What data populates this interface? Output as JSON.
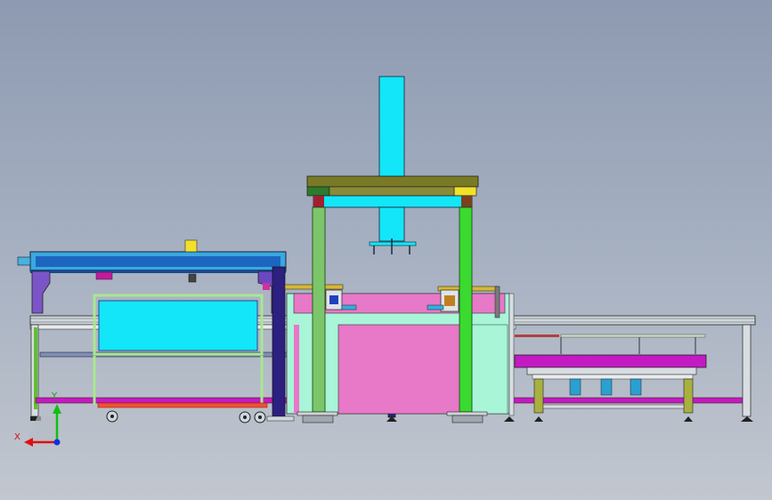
{
  "viewport": {
    "background_top": "#8e9ab1",
    "background_bottom": "#c2c7cf"
  },
  "triad": {
    "x_label": "X",
    "y_label": "Y",
    "x_color": "#e01010",
    "y_color": "#10c010",
    "z_color": "#1030e0"
  },
  "colors": {
    "column_cyan": "#11e1f5",
    "header_olive": "#7a7a26",
    "leg_green": "#7cc66a",
    "magenta_rail": "#c41ac4",
    "pink_panel": "#e878c8",
    "mint_panel": "#a8f5d8",
    "conveyor_blue": "#3aa8e0",
    "dark_post": "#2c2080",
    "yellow_block": "#f2e02a"
  }
}
